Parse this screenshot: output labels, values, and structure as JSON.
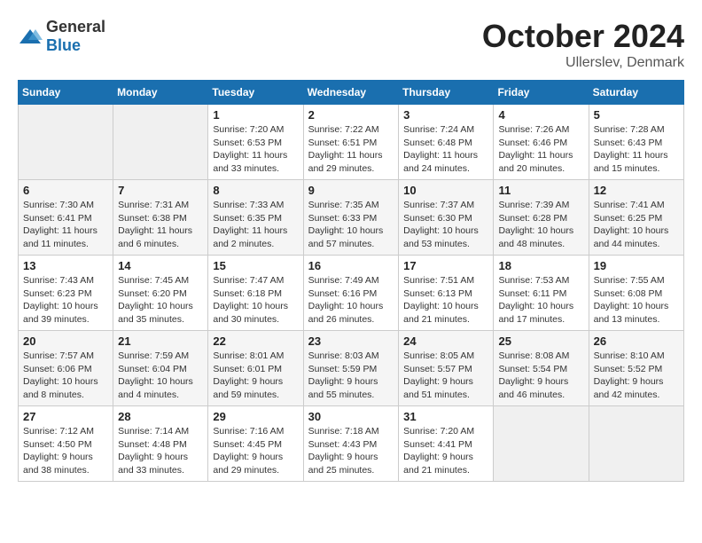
{
  "header": {
    "logo_general": "General",
    "logo_blue": "Blue",
    "month_title": "October 2024",
    "location": "Ullerslev, Denmark"
  },
  "weekdays": [
    "Sunday",
    "Monday",
    "Tuesday",
    "Wednesday",
    "Thursday",
    "Friday",
    "Saturday"
  ],
  "weeks": [
    [
      {
        "day": "",
        "info": ""
      },
      {
        "day": "",
        "info": ""
      },
      {
        "day": "1",
        "info": "Sunrise: 7:20 AM\nSunset: 6:53 PM\nDaylight: 11 hours\nand 33 minutes."
      },
      {
        "day": "2",
        "info": "Sunrise: 7:22 AM\nSunset: 6:51 PM\nDaylight: 11 hours\nand 29 minutes."
      },
      {
        "day": "3",
        "info": "Sunrise: 7:24 AM\nSunset: 6:48 PM\nDaylight: 11 hours\nand 24 minutes."
      },
      {
        "day": "4",
        "info": "Sunrise: 7:26 AM\nSunset: 6:46 PM\nDaylight: 11 hours\nand 20 minutes."
      },
      {
        "day": "5",
        "info": "Sunrise: 7:28 AM\nSunset: 6:43 PM\nDaylight: 11 hours\nand 15 minutes."
      }
    ],
    [
      {
        "day": "6",
        "info": "Sunrise: 7:30 AM\nSunset: 6:41 PM\nDaylight: 11 hours\nand 11 minutes."
      },
      {
        "day": "7",
        "info": "Sunrise: 7:31 AM\nSunset: 6:38 PM\nDaylight: 11 hours\nand 6 minutes."
      },
      {
        "day": "8",
        "info": "Sunrise: 7:33 AM\nSunset: 6:35 PM\nDaylight: 11 hours\nand 2 minutes."
      },
      {
        "day": "9",
        "info": "Sunrise: 7:35 AM\nSunset: 6:33 PM\nDaylight: 10 hours\nand 57 minutes."
      },
      {
        "day": "10",
        "info": "Sunrise: 7:37 AM\nSunset: 6:30 PM\nDaylight: 10 hours\nand 53 minutes."
      },
      {
        "day": "11",
        "info": "Sunrise: 7:39 AM\nSunset: 6:28 PM\nDaylight: 10 hours\nand 48 minutes."
      },
      {
        "day": "12",
        "info": "Sunrise: 7:41 AM\nSunset: 6:25 PM\nDaylight: 10 hours\nand 44 minutes."
      }
    ],
    [
      {
        "day": "13",
        "info": "Sunrise: 7:43 AM\nSunset: 6:23 PM\nDaylight: 10 hours\nand 39 minutes."
      },
      {
        "day": "14",
        "info": "Sunrise: 7:45 AM\nSunset: 6:20 PM\nDaylight: 10 hours\nand 35 minutes."
      },
      {
        "day": "15",
        "info": "Sunrise: 7:47 AM\nSunset: 6:18 PM\nDaylight: 10 hours\nand 30 minutes."
      },
      {
        "day": "16",
        "info": "Sunrise: 7:49 AM\nSunset: 6:16 PM\nDaylight: 10 hours\nand 26 minutes."
      },
      {
        "day": "17",
        "info": "Sunrise: 7:51 AM\nSunset: 6:13 PM\nDaylight: 10 hours\nand 21 minutes."
      },
      {
        "day": "18",
        "info": "Sunrise: 7:53 AM\nSunset: 6:11 PM\nDaylight: 10 hours\nand 17 minutes."
      },
      {
        "day": "19",
        "info": "Sunrise: 7:55 AM\nSunset: 6:08 PM\nDaylight: 10 hours\nand 13 minutes."
      }
    ],
    [
      {
        "day": "20",
        "info": "Sunrise: 7:57 AM\nSunset: 6:06 PM\nDaylight: 10 hours\nand 8 minutes."
      },
      {
        "day": "21",
        "info": "Sunrise: 7:59 AM\nSunset: 6:04 PM\nDaylight: 10 hours\nand 4 minutes."
      },
      {
        "day": "22",
        "info": "Sunrise: 8:01 AM\nSunset: 6:01 PM\nDaylight: 9 hours\nand 59 minutes."
      },
      {
        "day": "23",
        "info": "Sunrise: 8:03 AM\nSunset: 5:59 PM\nDaylight: 9 hours\nand 55 minutes."
      },
      {
        "day": "24",
        "info": "Sunrise: 8:05 AM\nSunset: 5:57 PM\nDaylight: 9 hours\nand 51 minutes."
      },
      {
        "day": "25",
        "info": "Sunrise: 8:08 AM\nSunset: 5:54 PM\nDaylight: 9 hours\nand 46 minutes."
      },
      {
        "day": "26",
        "info": "Sunrise: 8:10 AM\nSunset: 5:52 PM\nDaylight: 9 hours\nand 42 minutes."
      }
    ],
    [
      {
        "day": "27",
        "info": "Sunrise: 7:12 AM\nSunset: 4:50 PM\nDaylight: 9 hours\nand 38 minutes."
      },
      {
        "day": "28",
        "info": "Sunrise: 7:14 AM\nSunset: 4:48 PM\nDaylight: 9 hours\nand 33 minutes."
      },
      {
        "day": "29",
        "info": "Sunrise: 7:16 AM\nSunset: 4:45 PM\nDaylight: 9 hours\nand 29 minutes."
      },
      {
        "day": "30",
        "info": "Sunrise: 7:18 AM\nSunset: 4:43 PM\nDaylight: 9 hours\nand 25 minutes."
      },
      {
        "day": "31",
        "info": "Sunrise: 7:20 AM\nSunset: 4:41 PM\nDaylight: 9 hours\nand 21 minutes."
      },
      {
        "day": "",
        "info": ""
      },
      {
        "day": "",
        "info": ""
      }
    ]
  ]
}
